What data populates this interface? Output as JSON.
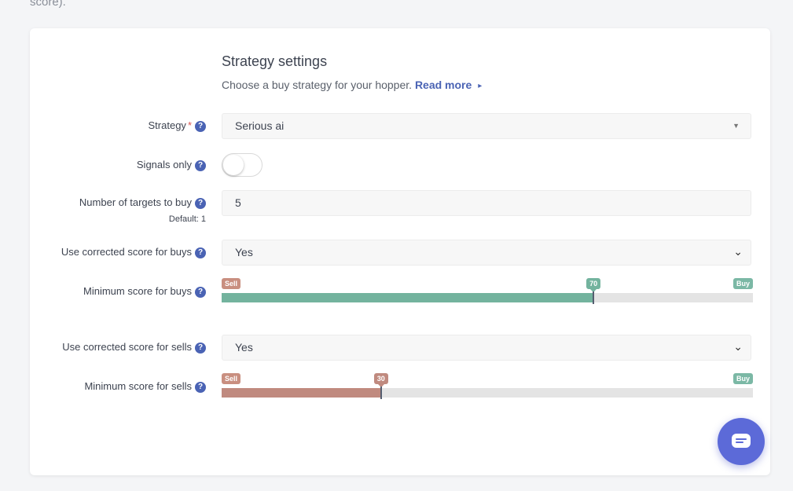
{
  "page_fragment": "score).",
  "header": {
    "title": "Strategy settings",
    "subtitle": "Choose a buy strategy for your hopper.",
    "read_more": "Read more",
    "read_more_caret": "▸"
  },
  "help_glyph": "?",
  "required_mark": "*",
  "fields": {
    "strategy": {
      "label": "Strategy",
      "value": "Serious ai",
      "arrow": "▼"
    },
    "signals_only": {
      "label": "Signals only",
      "on": false
    },
    "targets": {
      "label": "Number of targets to buy",
      "hint": "Default: 1",
      "value": "5"
    },
    "corrected_buys": {
      "label": "Use corrected score for buys",
      "value": "Yes",
      "chevron": "⌄"
    },
    "min_buys": {
      "label": "Minimum score for buys",
      "sell_tag": "Sell",
      "buy_tag": "Buy",
      "value": 70,
      "value_label": "70",
      "min": 0,
      "max": 100,
      "color": "#73b39e"
    },
    "corrected_sells": {
      "label": "Use corrected score for sells",
      "value": "Yes",
      "chevron": "⌄"
    },
    "min_sells": {
      "label": "Minimum score for sells",
      "sell_tag": "Sell",
      "buy_tag": "Buy",
      "value": 30,
      "value_label": "30",
      "min": 0,
      "max": 100,
      "color": "#c08a7f"
    }
  },
  "colors": {
    "accent": "#4a63b4",
    "sell": "#c98f80",
    "buy": "#7bb8a5",
    "chat": "#5c6ad8"
  }
}
